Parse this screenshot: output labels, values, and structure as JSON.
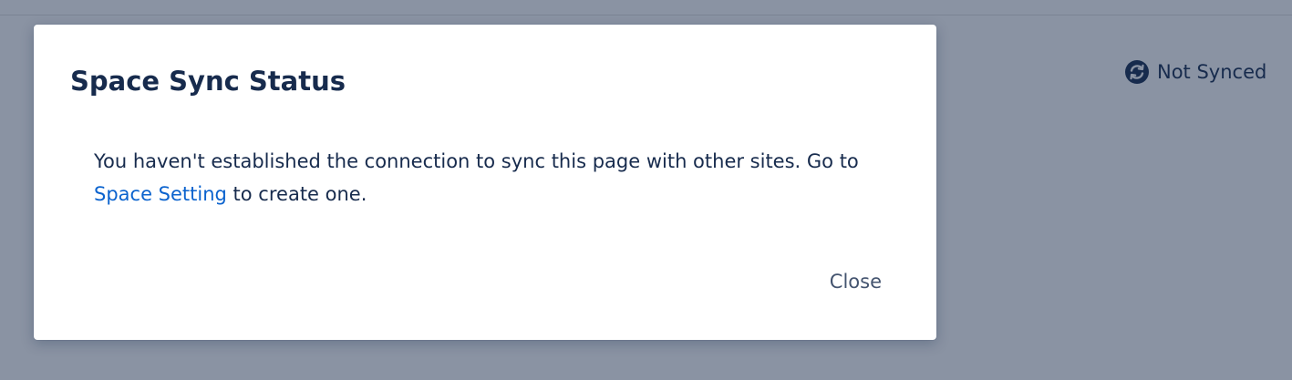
{
  "page": {
    "sync_status": {
      "icon": "sync-icon",
      "label": "Not Synced"
    }
  },
  "modal": {
    "title": "Space Sync Status",
    "body_before_link": "You haven't established the connection to sync this page with other sites. Go to ",
    "link_label": "Space Setting",
    "body_after_link": " to create one.",
    "close_label": "Close"
  },
  "colors": {
    "overlay": "#8a93a3",
    "text": "#172b4d",
    "link": "#0b63ce",
    "close_text": "#44546f"
  }
}
